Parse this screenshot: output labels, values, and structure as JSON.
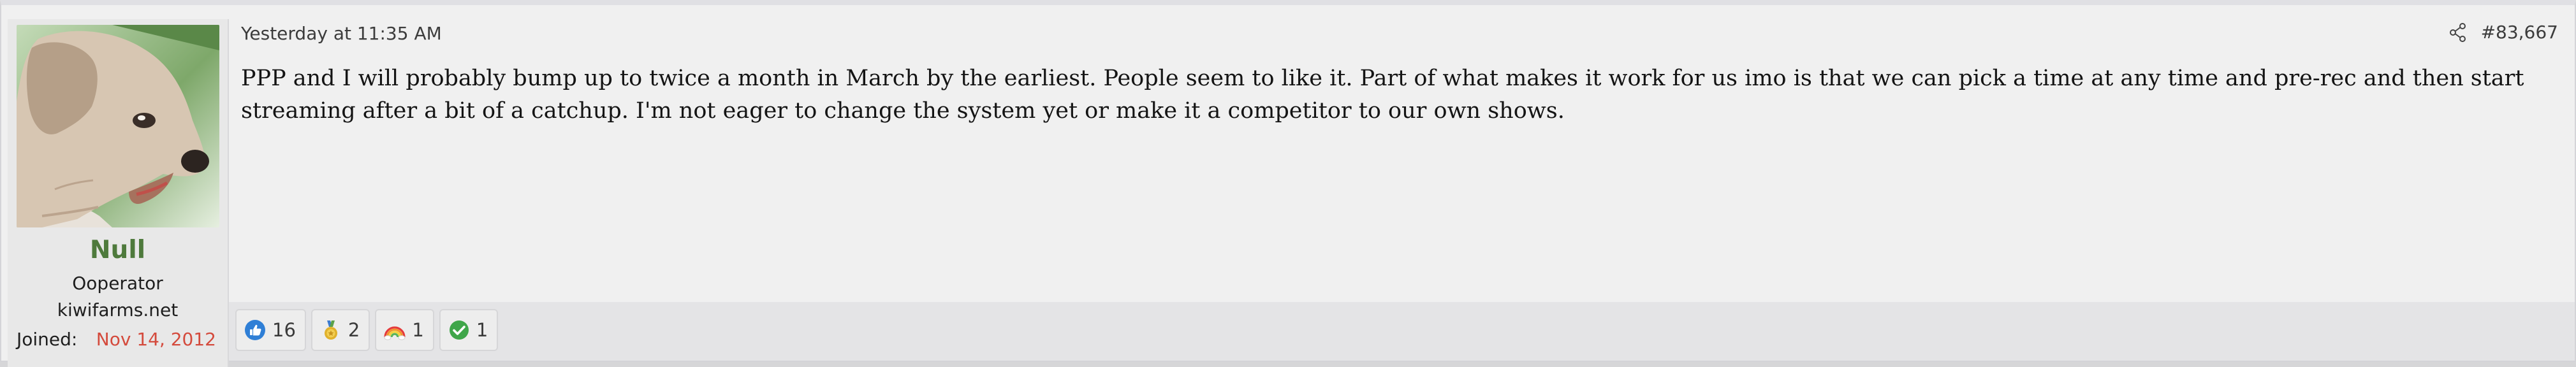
{
  "user": {
    "name": "Null",
    "title": "Ooperator",
    "site": "kiwifarms.net",
    "joined_label": "Joined:",
    "joined_date": "Nov 14, 2012",
    "name_color": "#4e7a3c",
    "joined_date_color": "#d44a3c",
    "avatar_icon": "dog-avatar"
  },
  "post": {
    "timestamp": "Yesterday at 11:35 AM",
    "number": "#83,667",
    "share_icon": "share-icon",
    "body": "PPP and I will probably bump up to twice a month in March by the earliest. People seem to like it. Part of what makes it work for us imo is that we can pick a time at any time and pre-rec and then start streaming after a bit of a catchup. I'm not eager to change the system yet or make it a competitor to our own shows."
  },
  "reactions": [
    {
      "icon": "thumbs-up-icon",
      "count": "16"
    },
    {
      "icon": "medal-icon",
      "count": "2"
    },
    {
      "icon": "rainbow-icon",
      "count": "1"
    },
    {
      "icon": "checkmark-icon",
      "count": "1"
    }
  ]
}
